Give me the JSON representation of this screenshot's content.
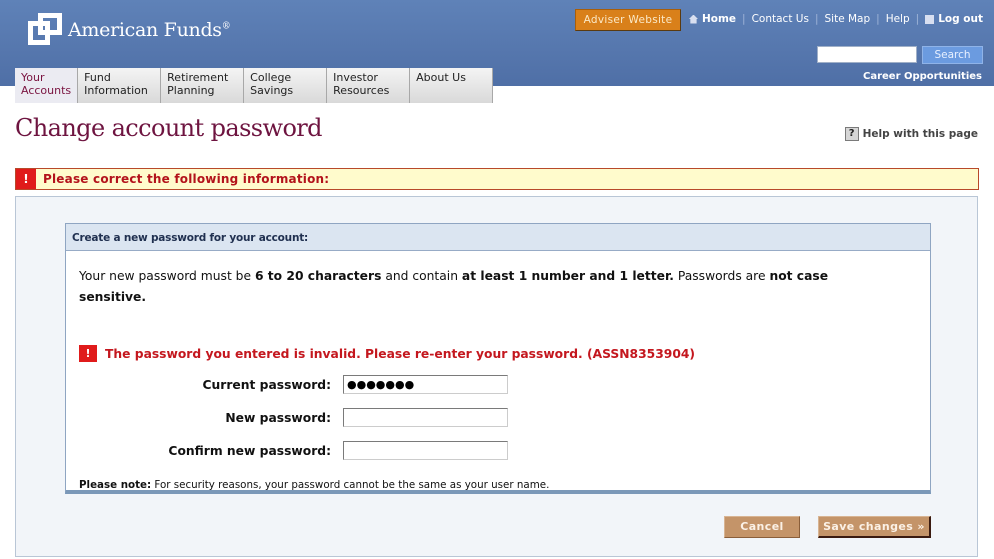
{
  "header": {
    "brand": "American Funds",
    "brand_mark": "®",
    "adviser_button": "Adviser Website",
    "top_links": {
      "home": "Home",
      "contact": "Contact Us",
      "sitemap": "Site Map",
      "help": "Help",
      "logout": "Log out",
      "separator": "|"
    },
    "search": {
      "value": "",
      "button": "Search"
    },
    "career": "Career Opportunities"
  },
  "nav": {
    "tabs": [
      {
        "line1": "Your",
        "line2": "Accounts",
        "active": true
      },
      {
        "line1": "Fund",
        "line2": "Information"
      },
      {
        "line1": "Retirement",
        "line2": "Planning"
      },
      {
        "line1": "College",
        "line2": "Savings"
      },
      {
        "line1": "Investor",
        "line2": "Resources"
      },
      {
        "line1": "About Us",
        "line2": ""
      }
    ]
  },
  "page": {
    "title": "Change account password",
    "help_link": "Help with this page",
    "help_icon": "?"
  },
  "error_banner": {
    "icon": "!",
    "message": "Please correct the following information:"
  },
  "form": {
    "heading": "Create a new password for your account:",
    "rules": {
      "t1": "Your new password must be ",
      "b1": "6 to 20 characters",
      "t2": " and contain ",
      "b2": "at least 1 number and 1 letter.",
      "t3": " Passwords are ",
      "b3": "not case sensitive."
    },
    "error": {
      "icon": "!",
      "message": "The password you entered is invalid. Please re-enter your password. (ASSN8353904)"
    },
    "fields": [
      {
        "label": "Current password:",
        "value": "●●●●●●●"
      },
      {
        "label": "New password:",
        "value": ""
      },
      {
        "label": "Confirm new password:",
        "value": ""
      }
    ],
    "note_label": "Please note:",
    "note_text": " For security reasons, your password cannot be the same as your user name."
  },
  "actions": {
    "cancel": "Cancel",
    "save": "Save changes »"
  },
  "colors": {
    "header_blue": "#4f6fa6",
    "title_maroon": "#6e1440",
    "error_red": "#c4171e",
    "adviser_orange": "#d9801a",
    "button_tan": "#c49469"
  }
}
